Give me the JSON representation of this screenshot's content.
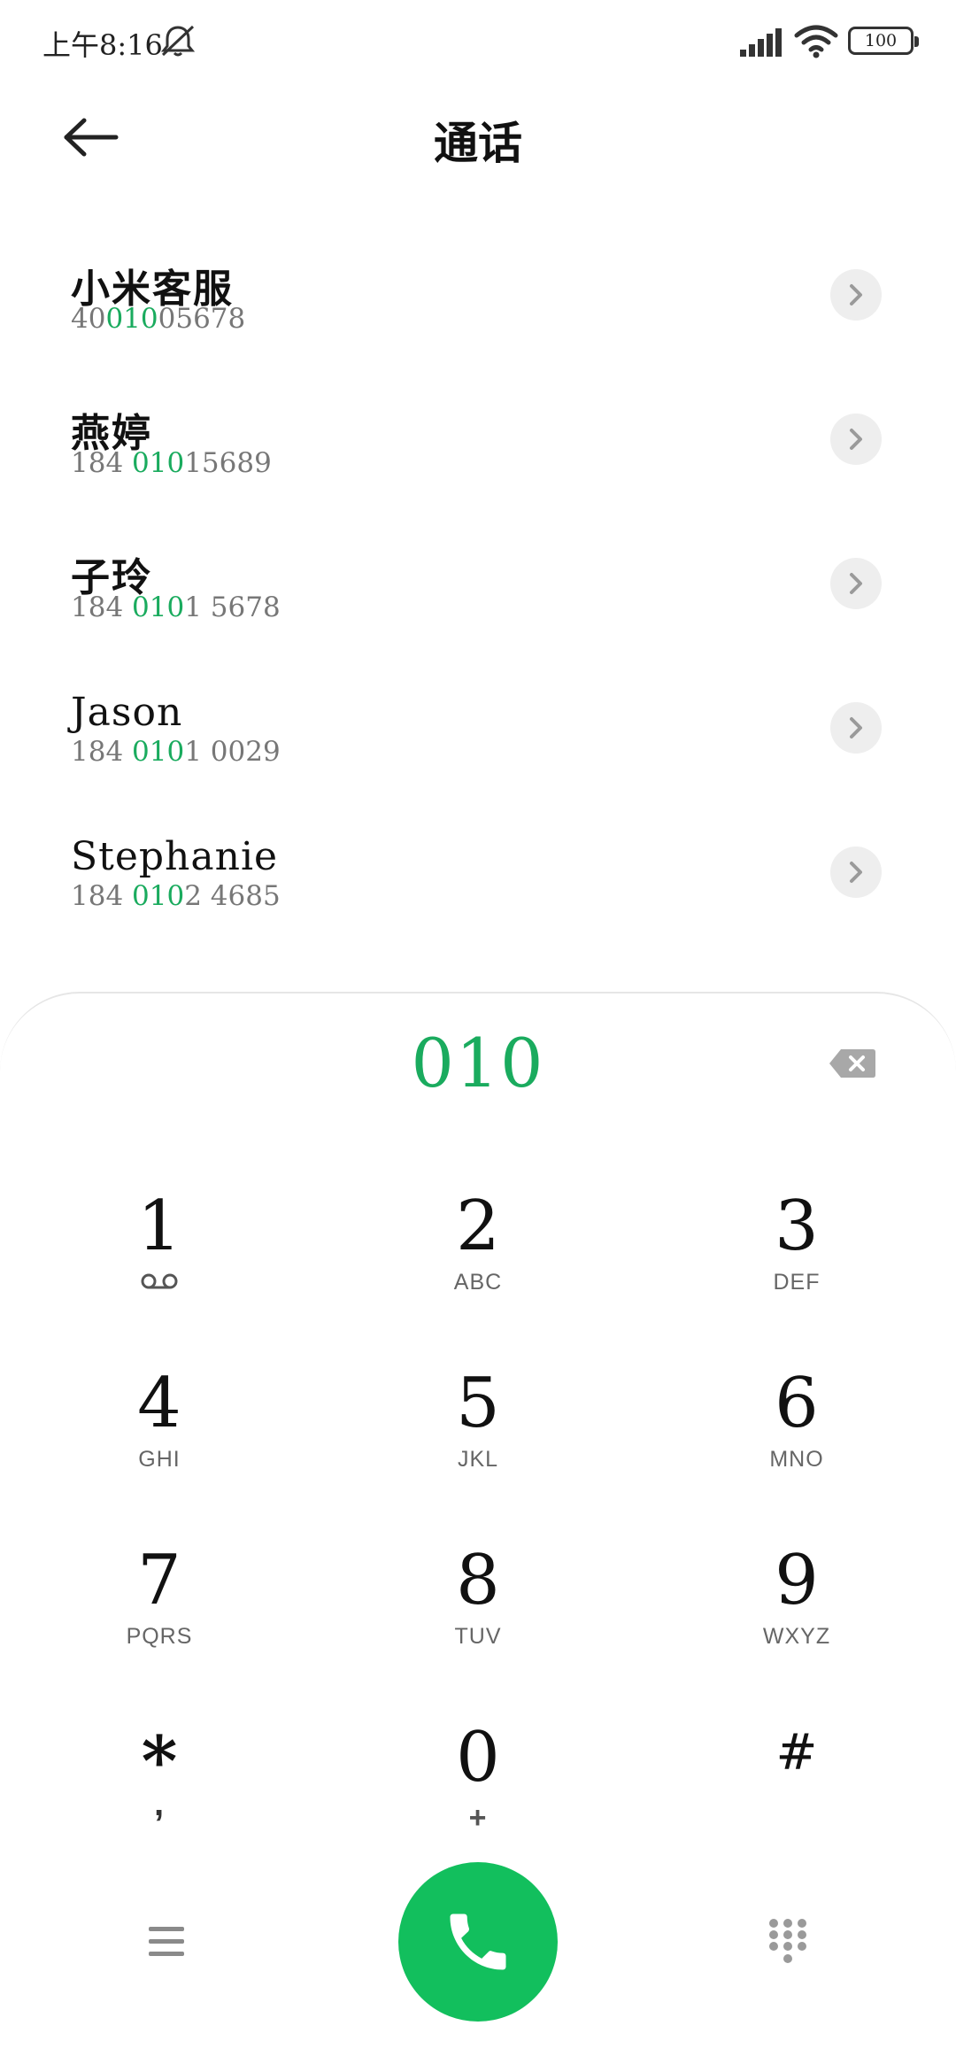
{
  "status_bar": {
    "time": "上午8:16",
    "battery": "100"
  },
  "header": {
    "title": "通话"
  },
  "contacts": [
    {
      "name": "小米客服",
      "number_pre": "40",
      "number_match": "010",
      "number_post": "05678"
    },
    {
      "name": "燕婷",
      "number_pre": "184 ",
      "number_match": "010",
      "number_post": "15689"
    },
    {
      "name": "子玲",
      "number_pre": "184 ",
      "number_match": "010",
      "number_post": "1 5678"
    },
    {
      "name": "Jason",
      "number_pre": "184 ",
      "number_match": "010",
      "number_post": "1 0029"
    },
    {
      "name": "Stephanie",
      "number_pre": "184 ",
      "number_match": "010",
      "number_post": "2 4685"
    }
  ],
  "dialer": {
    "input": "010",
    "keys": [
      {
        "digit": "1",
        "letters": ""
      },
      {
        "digit": "2",
        "letters": "ABC"
      },
      {
        "digit": "3",
        "letters": "DEF"
      },
      {
        "digit": "4",
        "letters": "GHI"
      },
      {
        "digit": "5",
        "letters": "JKL"
      },
      {
        "digit": "6",
        "letters": "MNO"
      },
      {
        "digit": "7",
        "letters": "PQRS"
      },
      {
        "digit": "8",
        "letters": "TUV"
      },
      {
        "digit": "9",
        "letters": "WXYZ"
      },
      {
        "digit": "*",
        "letters": ","
      },
      {
        "digit": "0",
        "letters": "+"
      },
      {
        "digit": "#",
        "letters": ""
      }
    ]
  },
  "colors": {
    "accent": "#1aab5e",
    "call_button": "#12bf5d",
    "chevron_bg": "#eeeeee"
  },
  "icons": {
    "back": "arrow-left-icon",
    "row_action": "chevron-right-icon",
    "backspace": "backspace-icon",
    "menu": "hamburger-menu-icon",
    "call": "phone-icon",
    "dialpad": "dialpad-icon",
    "voicemail": "voicemail-icon"
  }
}
